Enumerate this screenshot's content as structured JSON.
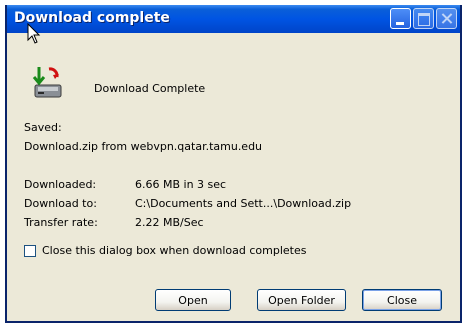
{
  "window": {
    "title": "Download complete"
  },
  "content": {
    "heading": "Download Complete",
    "saved_label": "Saved:",
    "saved_value": "Download.zip from webvpn.qatar.tamu.edu",
    "rows": [
      {
        "label": "Downloaded:",
        "value": "6.66 MB in 3 sec"
      },
      {
        "label": "Download to:",
        "value": "C:\\Documents and Sett...\\Download.zip"
      },
      {
        "label": "Transfer rate:",
        "value": "2.22 MB/Sec"
      }
    ],
    "close_checkbox": {
      "label": "Close this dialog box when download completes",
      "checked": false
    }
  },
  "buttons": {
    "open": "Open",
    "open_folder": "Open Folder",
    "close": "Close"
  },
  "colors": {
    "titlebar": "#0054e3",
    "dialog_bg": "#ece9d8"
  },
  "icons": [
    "download-complete-icon",
    "mouse-cursor-icon",
    "minimize-icon",
    "maximize-icon",
    "close-icon"
  ]
}
